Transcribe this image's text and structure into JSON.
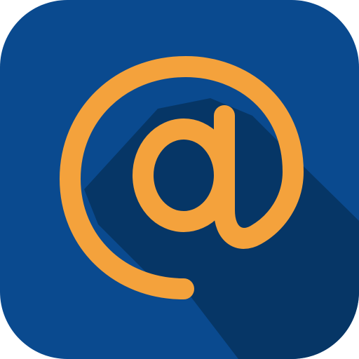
{
  "icon": {
    "name": "at-sign-icon",
    "glyph": "@",
    "colors": {
      "background": "#0a4a8f",
      "shadow": "#063666",
      "glyph": "#f4a23c"
    }
  }
}
